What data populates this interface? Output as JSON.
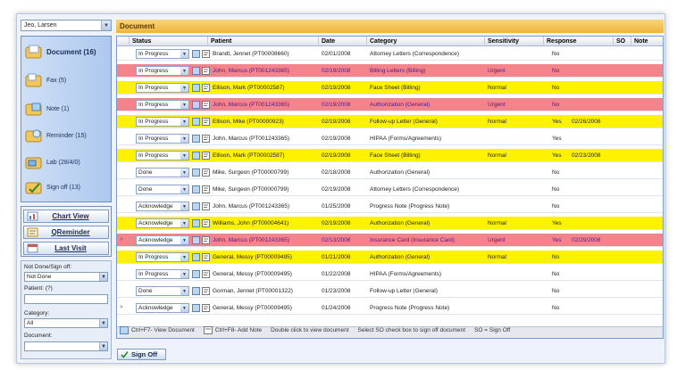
{
  "user_select": "Jeo, Larsen",
  "nav": [
    {
      "label": "Document (16)",
      "icon": "document-folder-icon"
    },
    {
      "label": "Fax (5)",
      "icon": "fax-folder-icon"
    },
    {
      "label": "Note (1)",
      "icon": "note-folder-icon"
    },
    {
      "label": "Reminder (15)",
      "icon": "reminder-folder-icon"
    },
    {
      "label": "Lab (28/4/0)",
      "icon": "lab-folder-icon"
    },
    {
      "label": "Sign off (13)",
      "icon": "sign-off-folder-icon"
    }
  ],
  "actions": {
    "chart_view": "Chart View",
    "q_reminder": "QReminder",
    "last_visit": "Last Visit"
  },
  "filters": {
    "signoff_label": "Not Done/Sign off:",
    "signoff_value": "Not Done",
    "patient_label": "Patient: (?)",
    "patient_value": "",
    "category_label": "Category:",
    "category_value": "All",
    "document_label": "Document:",
    "document_value": ""
  },
  "title": "Document",
  "columns": [
    "Status",
    "Patient",
    "Date",
    "Category",
    "Sensitivity",
    "Response",
    "SO",
    "Note"
  ],
  "rows": [
    {
      "status": "In Progress",
      "patient": "Brandt, Jennet (PT00008660)",
      "date": "02/01/2008",
      "category": "Attorney Letters (Correspondence)",
      "sensitivity": "",
      "response": "No",
      "resp_date": "",
      "color": "#ffffff",
      "arrow": ""
    },
    {
      "status": "In Progress",
      "patient": "John, Marcus (PT001243365)",
      "date": "02/19/2008",
      "category": "Billing Letters (Billing)",
      "sensitivity": "Urgent",
      "response": "No",
      "resp_date": "",
      "color": "#f4848c",
      "arrow": ""
    },
    {
      "status": "In Progress",
      "patient": "Ellison, Mark (PT00002587)",
      "date": "02/19/2008",
      "category": "Face Sheet (Billing)",
      "sensitivity": "Normal",
      "response": "No",
      "resp_date": "",
      "color": "#fff200",
      "arrow": ""
    },
    {
      "status": "In Progress",
      "patient": "John, Marcus (PT001243365)",
      "date": "02/19/2008",
      "category": "Authorization (General)",
      "sensitivity": "Urgent",
      "response": "No",
      "resp_date": "",
      "color": "#f4848c",
      "arrow": ""
    },
    {
      "status": "In Progress",
      "patient": "Ellison, Mike (PT00000923)",
      "date": "02/19/2008",
      "category": "Follow-up Letter (General)",
      "sensitivity": "Normal",
      "response": "Yes",
      "resp_date": "02/26/2008",
      "color": "#fff200",
      "arrow": ""
    },
    {
      "status": "In Progress",
      "patient": "John, Marcus (PT001243365)",
      "date": "02/19/2008",
      "category": "HIPAA (Forms/Agreements)",
      "sensitivity": "",
      "response": "Yes",
      "resp_date": "",
      "color": "#ffffff",
      "arrow": ""
    },
    {
      "status": "In Progress",
      "patient": "Ellison, Mark (PT00002587)",
      "date": "02/19/2008",
      "category": "Face Sheet (Billing)",
      "sensitivity": "Normal",
      "response": "Yes",
      "resp_date": "02/23/2008",
      "color": "#fff200",
      "arrow": ""
    },
    {
      "status": "Done",
      "patient": "Mike, Surgeon (PT00000799)",
      "date": "02/18/2008",
      "category": "Authorization (General)",
      "sensitivity": "",
      "response": "No",
      "resp_date": "",
      "color": "#ffffff",
      "arrow": ""
    },
    {
      "status": "Done",
      "patient": "Mike, Surgeon (PT00000799)",
      "date": "02/19/2008",
      "category": "Attorney Letters (Correspondence)",
      "sensitivity": "",
      "response": "No",
      "resp_date": "",
      "color": "#ffffff",
      "arrow": ""
    },
    {
      "status": "Acknowledge",
      "patient": "John, Marcus (PT001243365)",
      "date": "01/25/2008",
      "category": "Progress Note (Progress Note)",
      "sensitivity": "",
      "response": "No",
      "resp_date": "",
      "color": "#ffffff",
      "arrow": ""
    },
    {
      "status": "Acknowledge",
      "patient": "Williams, John (PT00004641)",
      "date": "02/19/2008",
      "category": "Authorization (General)",
      "sensitivity": "Normal",
      "response": "Yes",
      "resp_date": "",
      "color": "#fff200",
      "arrow": ""
    },
    {
      "status": "Acknowledge",
      "patient": "John, Marcus (PT001243365)",
      "date": "02/13/2008",
      "category": "Insurance Card (Insurance Card)",
      "sensitivity": "Urgent",
      "response": "Yes",
      "resp_date": "02/29/2008",
      "color": "#f4848c",
      "arrow": ">"
    },
    {
      "status": "In Progress",
      "patient": "General, Messy (PT00009495)",
      "date": "01/21/2008",
      "category": "Authorization (General)",
      "sensitivity": "Normal",
      "response": "No",
      "resp_date": "",
      "color": "#fff200",
      "arrow": ""
    },
    {
      "status": "In Progress",
      "patient": "General, Messy (PT00009495)",
      "date": "01/22/2008",
      "category": "HIPAA (Forms/Agreements)",
      "sensitivity": "",
      "response": "No",
      "resp_date": "",
      "color": "#ffffff",
      "arrow": ""
    },
    {
      "status": "Done",
      "patient": "Gorman, Jennet (PT00001322)",
      "date": "01/23/2008",
      "category": "Follow-up Letter (General)",
      "sensitivity": "",
      "response": "No",
      "resp_date": "",
      "color": "#ffffff",
      "arrow": ""
    },
    {
      "status": "Acknowledge",
      "patient": "General, Messy (PT00009495)",
      "date": "01/24/2008",
      "category": "Progress Note (Progress Note)",
      "sensitivity": "",
      "response": "No",
      "resp_date": "",
      "color": "#ffffff",
      "arrow": ">"
    }
  ],
  "info": {
    "view_doc": "Ctrl+F7- View Document",
    "add_note": "Ctrl+F8- Add Note",
    "dbl_click": "Double click to view document",
    "select_so": "Select SO check box to sign off document",
    "so_legend": "SO = Sign Off"
  },
  "signoff_button": "Sign Off"
}
